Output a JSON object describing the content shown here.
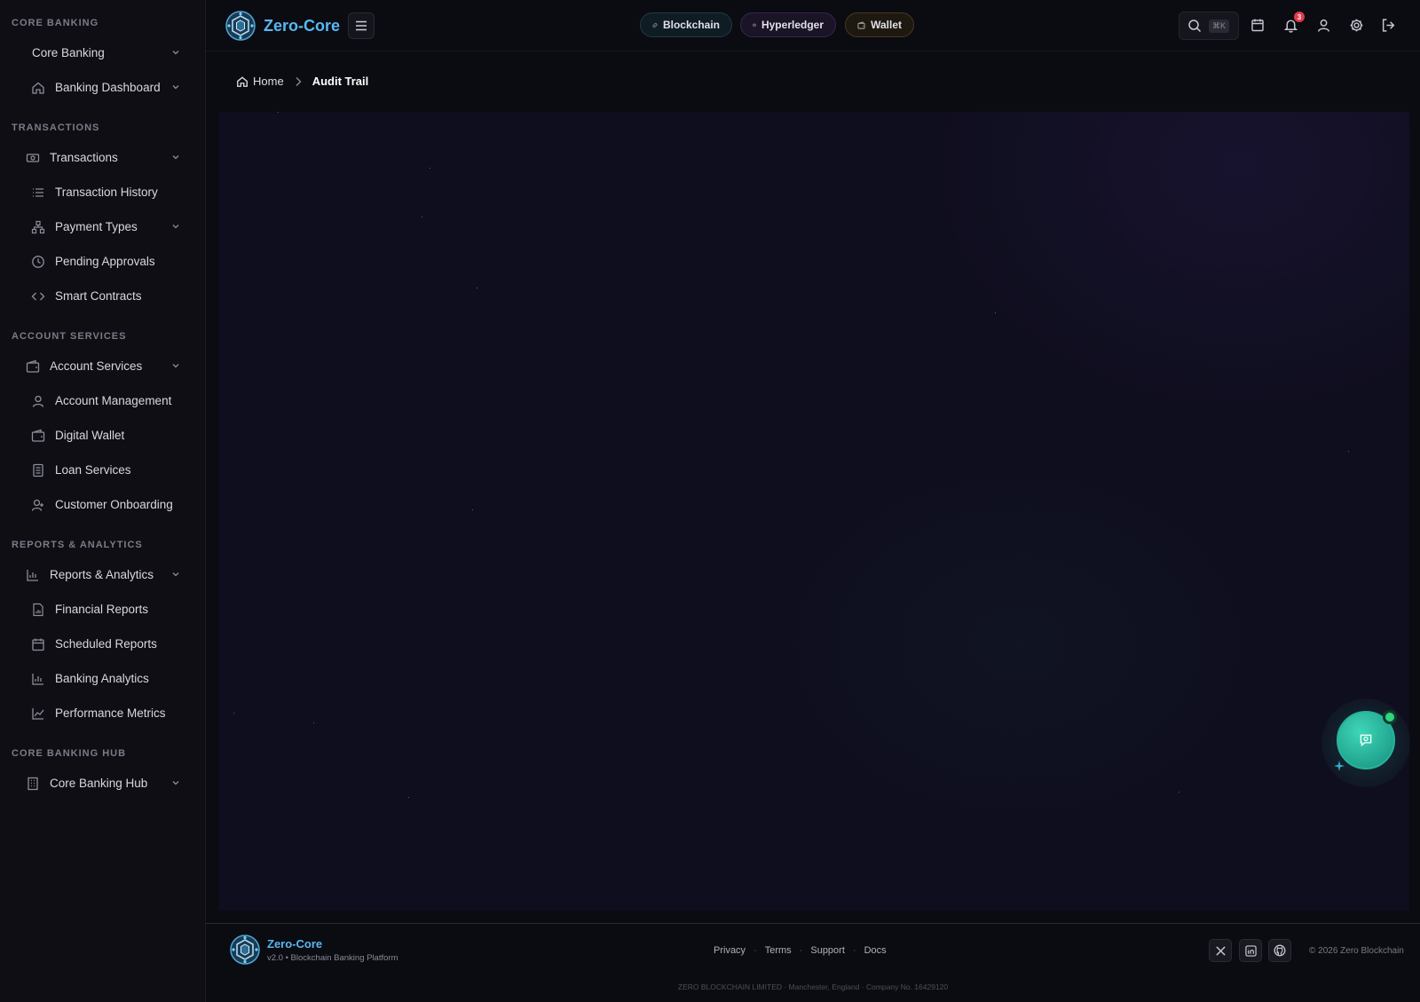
{
  "sidebar": {
    "sections": [
      {
        "title": "CORE BANKING",
        "items": [
          {
            "label": "Core Banking",
            "icon": "none",
            "expandable": true
          },
          {
            "label": "Banking Dashboard",
            "icon": "home-icon",
            "expandable": true
          }
        ]
      },
      {
        "title": "TRANSACTIONS",
        "items": [
          {
            "label": "Transactions",
            "icon": "banknote-icon",
            "expandable": true
          },
          {
            "label": "Transaction History",
            "icon": "list-icon",
            "expandable": false
          },
          {
            "label": "Payment Types",
            "icon": "network-icon",
            "expandable": true
          },
          {
            "label": "Pending Approvals",
            "icon": "clock-icon",
            "expandable": false
          },
          {
            "label": "Smart Contracts",
            "icon": "code-icon",
            "expandable": false
          }
        ]
      },
      {
        "title": "ACCOUNT SERVICES",
        "items": [
          {
            "label": "Account Services",
            "icon": "wallet-icon",
            "expandable": true
          },
          {
            "label": "Account Management",
            "icon": "user-icon",
            "expandable": false
          },
          {
            "label": "Digital Wallet",
            "icon": "wallet-icon",
            "expandable": false
          },
          {
            "label": "Loan Services",
            "icon": "document-icon",
            "expandable": false
          },
          {
            "label": "Customer Onboarding",
            "icon": "user-plus-icon",
            "expandable": false
          }
        ]
      },
      {
        "title": "REPORTS & ANALYTICS",
        "items": [
          {
            "label": "Reports & Analytics",
            "icon": "bar-chart-icon",
            "expandable": true
          },
          {
            "label": "Financial Reports",
            "icon": "file-chart-icon",
            "expandable": false
          },
          {
            "label": "Scheduled Reports",
            "icon": "calendar-icon",
            "expandable": false
          },
          {
            "label": "Banking Analytics",
            "icon": "bar-chart-icon",
            "expandable": false
          },
          {
            "label": "Performance Metrics",
            "icon": "line-chart-icon",
            "expandable": false
          }
        ]
      },
      {
        "title": "CORE BANKING HUB",
        "items": [
          {
            "label": "Core Banking Hub",
            "icon": "building-icon",
            "expandable": true
          }
        ]
      }
    ]
  },
  "header": {
    "brand": "Zero-Core",
    "chips": {
      "blockchain": "Blockchain",
      "hyperledger": "Hyperledger",
      "wallet": "Wallet"
    },
    "search_shortcut": "⌘K",
    "notification_count": "3"
  },
  "breadcrumb": {
    "home": "Home",
    "current": "Audit Trail"
  },
  "footer": {
    "brand": "Zero-Core",
    "tagline": "v2.0 • Blockchain Banking Platform",
    "links": [
      "Privacy",
      "Terms",
      "Support",
      "Docs"
    ],
    "copyright": "© 2026 Zero Blockchain",
    "legal": "ZERO BLOCKCHAIN LIMITED · Manchester, England · Company No. 16429120"
  },
  "colors": {
    "accent": "#58b8f0",
    "fab": "#2bbfa2",
    "online": "#2fd67a",
    "badge": "#e23a4a"
  }
}
